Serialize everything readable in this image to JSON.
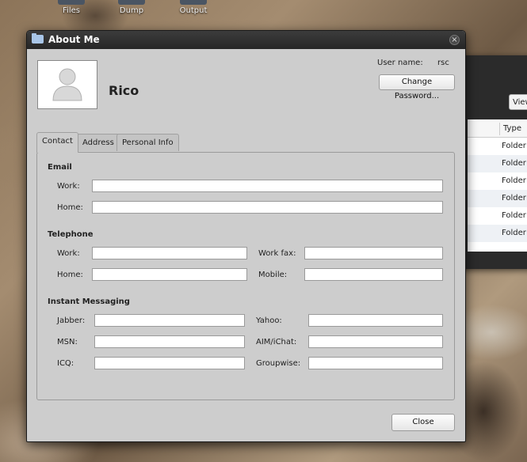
{
  "desktop": {
    "icons": [
      "Files",
      "Dump",
      "Output"
    ]
  },
  "bg_window": {
    "view_label": "View",
    "column_type": "Type",
    "rows": [
      "Folder",
      "Folder",
      "Folder",
      "Folder",
      "Folder",
      "Folder"
    ]
  },
  "dialog": {
    "title": "About Me",
    "name": "Rico",
    "user_label": "User name:",
    "user_value": "rsc",
    "change_password": "Change Password...",
    "close": "Close",
    "tabs": [
      "Contact",
      "Address",
      "Personal Info"
    ],
    "active_tab": "Contact"
  },
  "contact": {
    "email": {
      "heading": "Email",
      "work_label": "Work:",
      "home_label": "Home:",
      "work_value": "",
      "home_value": ""
    },
    "telephone": {
      "heading": "Telephone",
      "work_label": "Work:",
      "home_label": "Home:",
      "workfax_label": "Work fax:",
      "mobile_label": "Mobile:",
      "work_value": "",
      "home_value": "",
      "workfax_value": "",
      "mobile_value": ""
    },
    "im": {
      "heading": "Instant Messaging",
      "jabber_label": "Jabber:",
      "msn_label": "MSN:",
      "icq_label": "ICQ:",
      "yahoo_label": "Yahoo:",
      "aim_label": "AIM/iChat:",
      "groupwise_label": "Groupwise:",
      "jabber_value": "",
      "msn_value": "",
      "icq_value": "",
      "yahoo_value": "",
      "aim_value": "",
      "groupwise_value": ""
    }
  }
}
